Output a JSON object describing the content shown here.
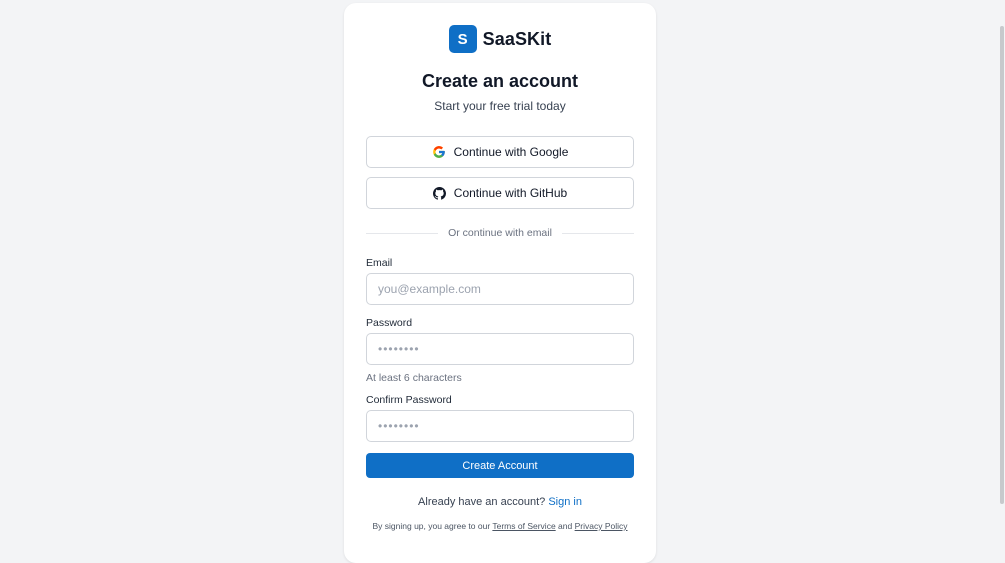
{
  "brand": {
    "logo_letter": "S",
    "name": "SaaSKit"
  },
  "header": {
    "title": "Create an account",
    "subtitle": "Start your free trial today"
  },
  "oauth": {
    "google_label": "Continue with Google",
    "github_label": "Continue with GitHub"
  },
  "divider_text": "Or continue with email",
  "form": {
    "email": {
      "label": "Email",
      "placeholder": "you@example.com",
      "value": ""
    },
    "password": {
      "label": "Password",
      "placeholder": "••••••••",
      "value": "",
      "hint": "At least 6 characters"
    },
    "confirm_password": {
      "label": "Confirm Password",
      "placeholder": "••••••••",
      "value": ""
    },
    "submit_label": "Create Account"
  },
  "signin": {
    "prompt": "Already have an account?",
    "link_label": "Sign in"
  },
  "legal": {
    "prefix": "By signing up, you agree to our",
    "terms_label": "Terms of Service",
    "and": "and",
    "privacy_label": "Privacy Policy"
  },
  "colors": {
    "accent": "#0f6fc6",
    "background": "#f3f4f6",
    "card": "#ffffff",
    "border": "#d1d5db"
  },
  "icons": {
    "google": "google-icon",
    "github": "github-icon"
  }
}
